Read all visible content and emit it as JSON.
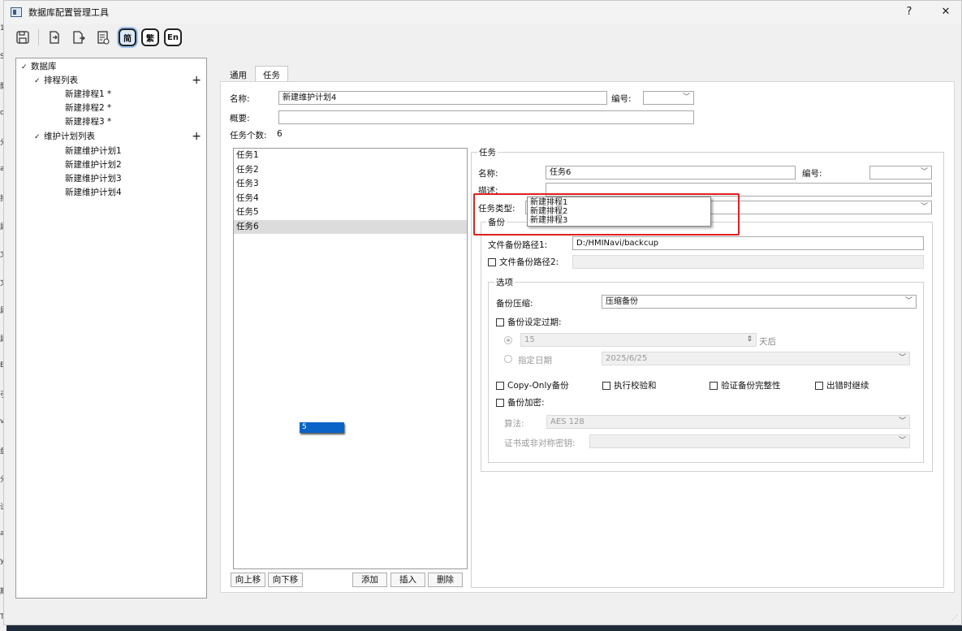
{
  "window": {
    "title": "数据库配置管理工具",
    "help": "?",
    "close": "✕"
  },
  "toolbar": {
    "lang_simplified": "简",
    "lang_traditional": "繁",
    "lang_english": "En"
  },
  "tree": {
    "root": "数据库",
    "schedule_group": "排程列表",
    "schedules": [
      "新建排程1 *",
      "新建排程2 *",
      "新建排程3 *"
    ],
    "plan_group": "维护计划列表",
    "plans": [
      "新建维护计划1",
      "新建维护计划2",
      "新建维护计划3",
      "新建维护计划4"
    ],
    "add": "+"
  },
  "tabs": [
    "通用",
    "任务"
  ],
  "plan": {
    "name_label": "名称:",
    "name_value": "新建维护计划4",
    "id_label": "编号:",
    "id_value": "",
    "summary_label": "概要:",
    "summary_value": "",
    "task_count_label": "任务个数:",
    "task_count": "6"
  },
  "task_list": {
    "items": [
      "任务1",
      "任务2",
      "任务3",
      "任务4",
      "任务5",
      "任务6"
    ],
    "selected": "任务6",
    "drag_label": "5",
    "buttons": {
      "up": "向上移",
      "down": "向下移",
      "add": "添加",
      "insert": "插入",
      "delete": "删除"
    }
  },
  "task": {
    "group_title": "任务",
    "name_label": "名称:",
    "name_value": "任务6",
    "id_label": "编号:",
    "id_value": "",
    "desc_label": "描述:",
    "desc_value": "",
    "type_label": "任务类型:",
    "type_value": "",
    "type_options": [
      "新建排程1",
      "新建排程2",
      "新建排程3"
    ],
    "backup_group": "备份",
    "path1_label": "文件备份路径1:",
    "path1_value": "D:/HMINavi/backcup",
    "path2_label": "文件备份路径2:",
    "path2_value": "",
    "options_group": "选项",
    "compress_label": "备份压缩:",
    "compress_value": "压缩备份",
    "expire_label": "备份设定过期:",
    "days_value": "15",
    "days_suffix": "天后",
    "date_label": "指定日期",
    "date_value": "2025/6/25",
    "copy_only_label": "Copy-Only备份",
    "checksum_label": "执行校验和",
    "verify_label": "验证备份完整性",
    "continue_label": "出错时继续",
    "encrypt_label": "备份加密:",
    "algo_label": "算法:",
    "algo_value": "AES 128",
    "cert_label": "证书或非对称密钥:",
    "cert_value": ""
  },
  "background_fragments": [
    "1",
    "SC",
    "開",
    "o",
    "分",
    "ai",
    "拍",
    "属",
    "文",
    "文",
    "属",
    "属",
    "E",
    "引",
    "v",
    "盘",
    "分",
    "试",
    "ai",
    "y",
    "期",
    "TIBI"
  ]
}
